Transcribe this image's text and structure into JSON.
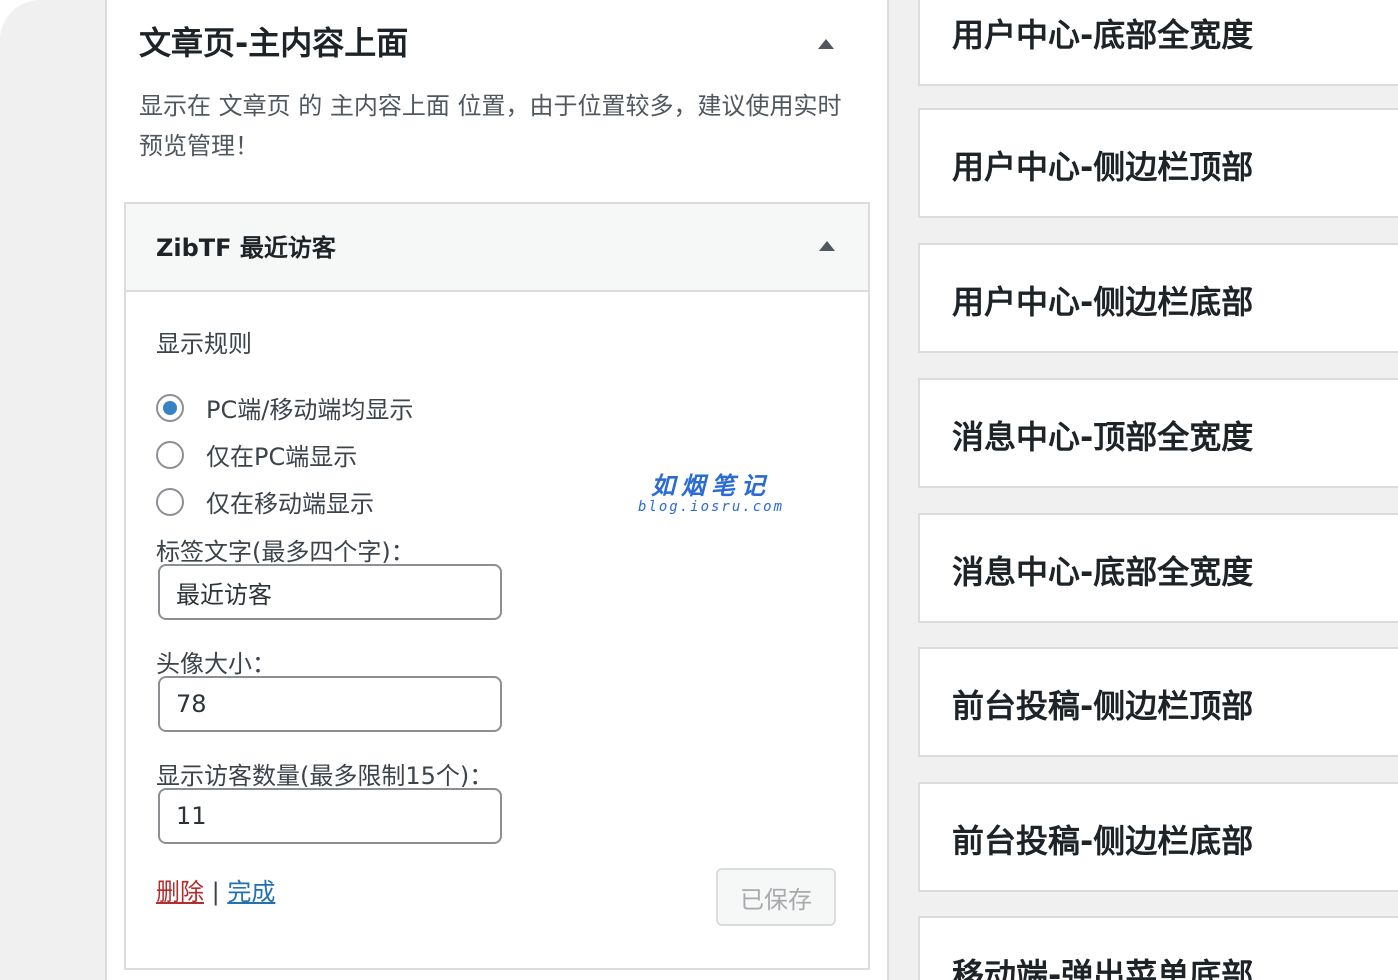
{
  "area": {
    "title": "文章页-主内容上面",
    "description": "显示在 文章页 的 主内容上面 位置，由于位置较多，建议使用实时预览管理！"
  },
  "widget": {
    "title": "ZibTF 最近访客",
    "display_rule_label": "显示规则",
    "display_options": [
      {
        "label": "PC端/移动端均显示",
        "checked": true
      },
      {
        "label": "仅在PC端显示",
        "checked": false
      },
      {
        "label": "仅在移动端显示",
        "checked": false
      }
    ],
    "tag_label": "标签文字(最多四个字)：",
    "tag_value": "最近访客",
    "avatar_label": "头像大小：",
    "avatar_value": "78",
    "count_label": "显示访客数量(最多限制15个)：",
    "count_value": "11",
    "delete_label": "删除",
    "separator": "|",
    "done_label": "完成",
    "save_label": "已保存"
  },
  "watermark": {
    "main": "如烟笔记",
    "sub": "blog.iosru.com"
  },
  "sidebar_areas": [
    "用户中心-底部全宽度",
    "用户中心-侧边栏顶部",
    "用户中心-侧边栏底部",
    "消息中心-顶部全宽度",
    "消息中心-底部全宽度",
    "前台投稿-侧边栏顶部",
    "前台投稿-侧边栏底部",
    "移动端-弹出菜单底部"
  ],
  "colors": {
    "accent": "#3582c4",
    "link": "#2271b1",
    "delete": "#b32d2e",
    "watermark": "#2a6bd6",
    "background": "#f0f0f1"
  }
}
